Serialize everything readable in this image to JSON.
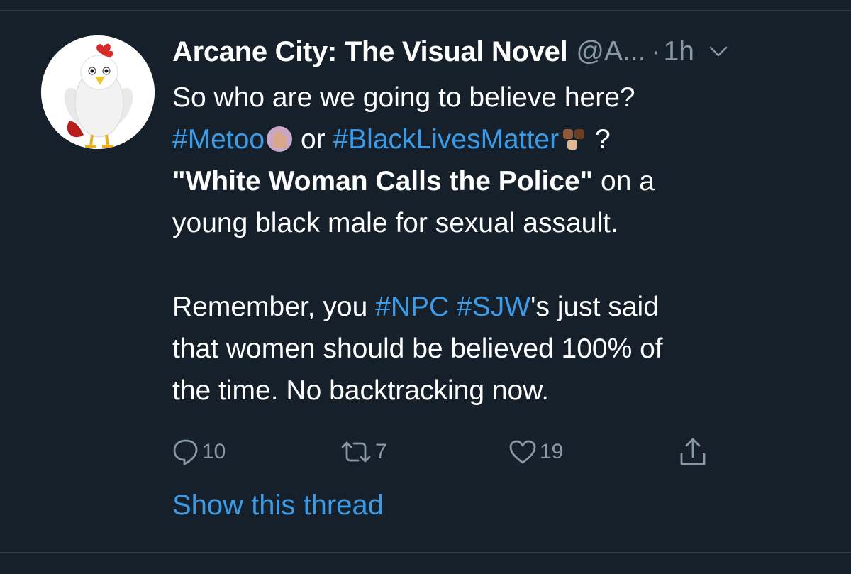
{
  "tweet": {
    "display_name": "Arcane City: The Visual Novel",
    "handle": "@A...",
    "separator": "·",
    "time": "1h",
    "lines": {
      "l1": "So who are we going to believe here?",
      "l2_tag1": "#Metoo",
      "l2_or": "or",
      "l2_tag2": "#BlackLivesMatter",
      "l2_q": "?",
      "l3_bold": "\"White Woman Calls the Police\"",
      "l3_rest": " on a",
      "l4": "young black male for sexual assault.",
      "l6_pre": "Remember, you ",
      "l6_tag1": "#NPC",
      "l6_tag2": "#SJW",
      "l6_post": "'s just said",
      "l7": "that women should be believed 100% of",
      "l8": "the time. No backtracking now."
    },
    "actions": {
      "reply_count": "10",
      "retweet_count": "7",
      "like_count": "19"
    },
    "show_thread": "Show this thread"
  },
  "icons": {
    "more": "chevron-down-icon",
    "reply": "reply-icon",
    "retweet": "retweet-icon",
    "like": "heart-icon",
    "share": "share-icon"
  },
  "colors": {
    "background": "#15202b",
    "text": "#ffffff",
    "muted": "#8899a6",
    "link": "#3b9be6"
  }
}
